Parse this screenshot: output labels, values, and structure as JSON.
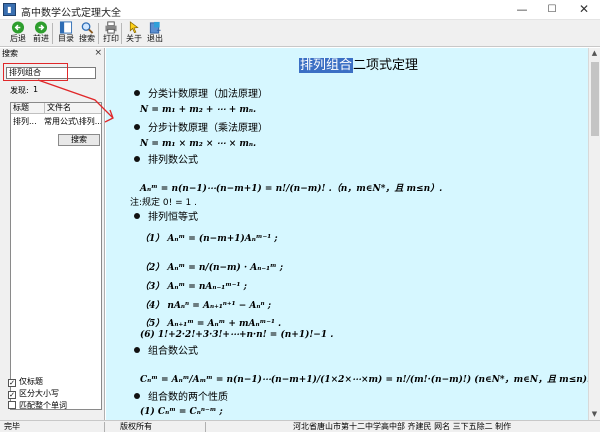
{
  "window": {
    "title": "高中数学公式定理大全",
    "icon": "app-book-icon"
  },
  "toolbar": [
    {
      "label": "后退",
      "icon": "back-arrow-icon",
      "color": "#2e9e2e"
    },
    {
      "label": "前进",
      "icon": "forward-arrow-icon",
      "color": "#2e9e2e"
    },
    {
      "label": "目录",
      "icon": "contents-icon",
      "color": "#2f6db5"
    },
    {
      "label": "搜索",
      "icon": "search-icon",
      "color": "#2f6db5"
    },
    {
      "label": "打印",
      "icon": "print-icon",
      "color": "#555555"
    },
    {
      "label": "关于",
      "icon": "about-icon",
      "color": "#d9a300"
    },
    {
      "label": "退出",
      "icon": "exit-icon",
      "color": "#2f6db5"
    }
  ],
  "panel": {
    "title": "搜索",
    "close": "×",
    "search_value": "排列组合",
    "hits_label": "发现:",
    "hits_value": "1",
    "search_button": "搜索",
    "columns": [
      "标题",
      "文件名"
    ],
    "rows": [
      {
        "title": "排列...",
        "file": "常用公式\\排列..."
      }
    ],
    "options": [
      {
        "label": "仅标题",
        "checked": true
      },
      {
        "label": "区分大小写",
        "checked": true
      },
      {
        "label": "匹配整个单词",
        "checked": false
      }
    ]
  },
  "content": {
    "title_highlight": "排列组合",
    "title_rest": "二项式定理",
    "background": "#d6f7ff",
    "sections": {
      "s1": "分类计数原理（加法原理）",
      "s2": "分步计数原理（乘法原理）",
      "s3": "排列数公式",
      "s4": "排列恒等式",
      "s5": "组合数公式",
      "s6": "组合数的两个性质"
    },
    "formulas": {
      "f1": "N = m₁ + m₂ + ⋯ + mₙ.",
      "f2": "N = m₁ × m₂ × ⋯ × mₙ.",
      "f3": "Aₙᵐ = n(n−1)⋯(n−m+1) = n!/(n−m)! .（n，m∈N*，且 m≤n）.",
      "note": "注:规定 0! = 1 .",
      "p1": "（1） Aₙᵐ = (n−m+1)Aₙᵐ⁻¹ ;",
      "p2": "（2） Aₙᵐ = n/(n−m) · Aₙ₋₁ᵐ ;",
      "p3": "（3） Aₙᵐ = nAₙ₋₁ᵐ⁻¹ ;",
      "p4": "（4） nAₙⁿ = Aₙ₊₁ⁿ⁺¹ − Aₙⁿ ;",
      "p5": "（5） Aₙ₊₁ᵐ = Aₙᵐ + mAₙᵐ⁻¹ .",
      "p6": "(6)  1!+2·2!+3·3!+⋯+n·n! = (n+1)!−1 .",
      "f4": "Cₙᵐ = Aₙᵐ/Aₘᵐ = n(n−1)⋯(n−m+1)/(1×2×⋯×m) = n!/(m!·(n−m)!)  (n∈N*，m∈N，且 m≤n).",
      "f5": "(1) Cₙᵐ = Cₙⁿ⁻ᵐ ;"
    }
  },
  "statusbar": {
    "left": "完毕",
    "mid": "版权所有",
    "right": "河北省唐山市第十二中学高中部   齐建民   网名  三下五除二   制作"
  },
  "annotation_color": "#e0282a"
}
